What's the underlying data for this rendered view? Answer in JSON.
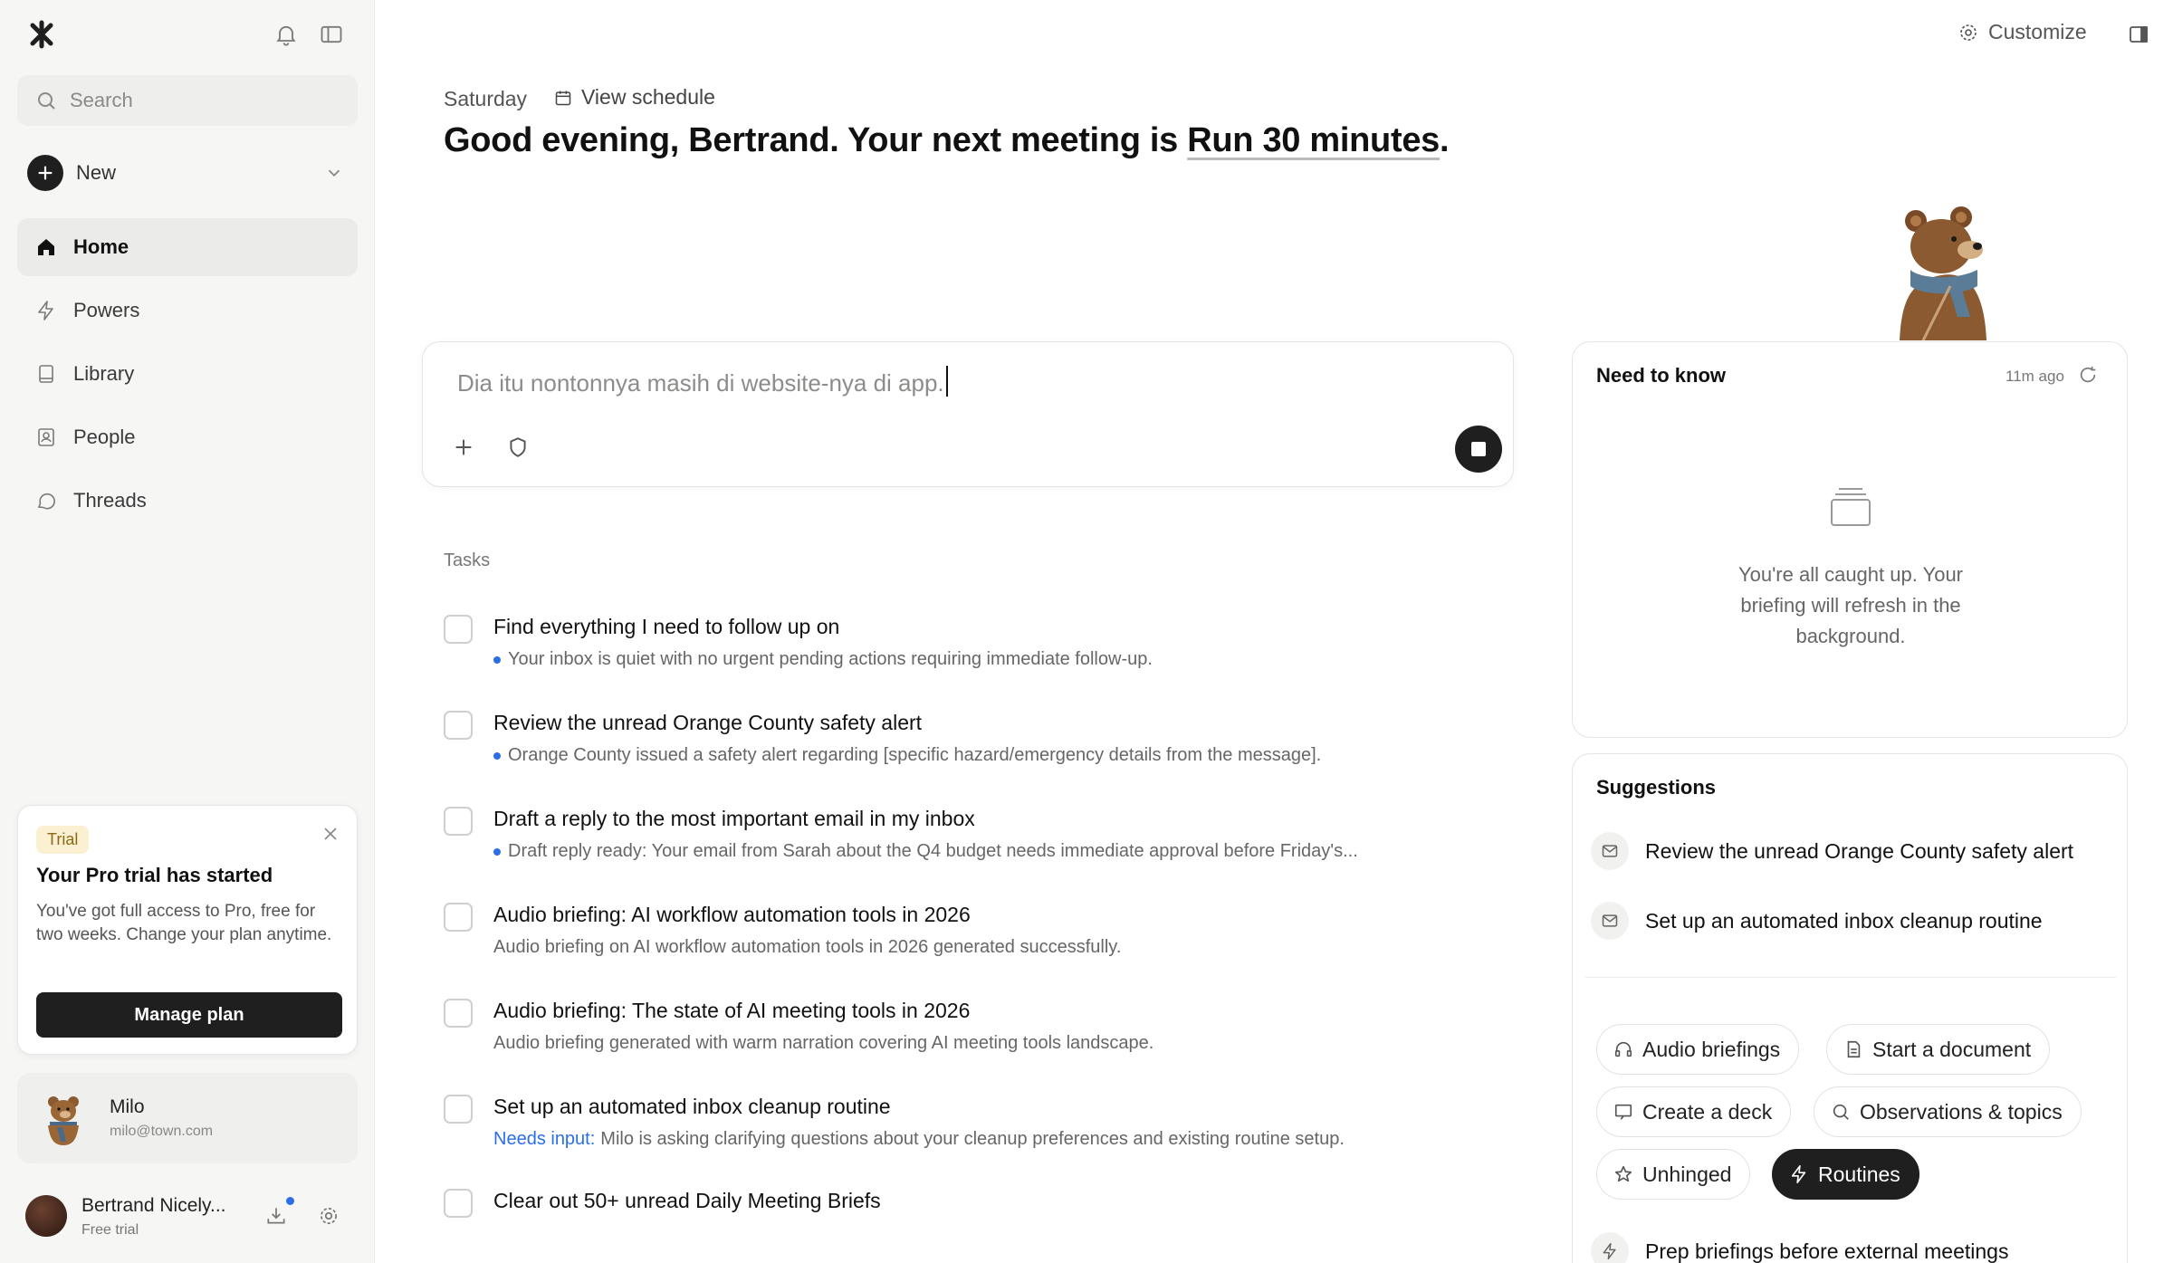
{
  "sidebar": {
    "search_placeholder": "Search",
    "new_label": "New",
    "items": [
      {
        "label": "Home",
        "icon": "home-icon"
      },
      {
        "label": "Powers",
        "icon": "bolt-icon"
      },
      {
        "label": "Library",
        "icon": "book-icon"
      },
      {
        "label": "People",
        "icon": "contact-icon"
      },
      {
        "label": "Threads",
        "icon": "chat-bubble-icon"
      }
    ],
    "trial": {
      "badge": "Trial",
      "title": "Your Pro trial has started",
      "text": "You've got full access to Pro, free for two weeks. Change your plan anytime.",
      "button": "Manage plan"
    },
    "assistant": {
      "name": "Milo",
      "email": "milo@town.com"
    },
    "user": {
      "name": "Bertrand Nicely...",
      "plan": "Free trial"
    }
  },
  "header": {
    "customize_label": "Customize",
    "day": "Saturday",
    "view_schedule": "View schedule",
    "greeting_prefix": "Good evening, Bertrand. Your next meeting is ",
    "meeting_name": "Run 30 minutes",
    "greeting_suffix": "."
  },
  "composer": {
    "text": "Dia itu nontonnya masih di website-nya di app."
  },
  "tasks": {
    "label": "Tasks",
    "items": [
      {
        "title": "Find everything I need to follow up on",
        "prefix": "",
        "sub": "Your inbox is quiet with no urgent pending actions requiring immediate follow-up.",
        "dot": true
      },
      {
        "title": "Review the unread Orange County safety alert",
        "prefix": "",
        "sub": "Orange County issued a safety alert regarding [specific hazard/emergency details from the message].",
        "dot": true
      },
      {
        "title": "Draft a reply to the most important email in my inbox",
        "prefix": "",
        "sub": "Draft reply ready: Your email from Sarah about the Q4 budget needs immediate approval before Friday's...",
        "dot": true
      },
      {
        "title": "Audio briefing: AI workflow automation tools in 2026",
        "prefix": "",
        "sub": "Audio briefing on AI workflow automation tools in 2026 generated successfully.",
        "dot": false
      },
      {
        "title": "Audio briefing: The state of AI meeting tools in 2026",
        "prefix": "",
        "sub": "Audio briefing generated with warm narration covering AI meeting tools landscape.",
        "dot": false
      },
      {
        "title": "Set up an automated inbox cleanup routine",
        "prefix": "Needs input:",
        "sub": "Milo is asking clarifying questions about your cleanup preferences and existing routine setup.",
        "dot": false
      },
      {
        "title": "Clear out 50+ unread Daily Meeting Briefs",
        "prefix": "",
        "sub": "",
        "dot": false
      }
    ]
  },
  "need_to_know": {
    "title": "Need to know",
    "time": "11m ago",
    "message": "You're all caught up. Your briefing will refresh in the background."
  },
  "suggestions": {
    "title": "Suggestions",
    "items": [
      "Review the unread Orange County safety alert",
      "Set up an automated inbox cleanup routine",
      "Prep briefings before external meetings"
    ],
    "chips": [
      {
        "label": "Audio briefings",
        "icon": "headphones-icon"
      },
      {
        "label": "Start a document",
        "icon": "document-icon"
      },
      {
        "label": "Create a deck",
        "icon": "presentation-icon"
      },
      {
        "label": "Observations & topics",
        "icon": "search-icon"
      },
      {
        "label": "Unhinged",
        "icon": "star-icon"
      },
      {
        "label": "Routines",
        "icon": "bolt-icon"
      }
    ]
  },
  "colors": {
    "accent_blue": "#2b6ee8",
    "dark": "#1f1f1f",
    "sidebar_bg": "#f6f6f5"
  }
}
